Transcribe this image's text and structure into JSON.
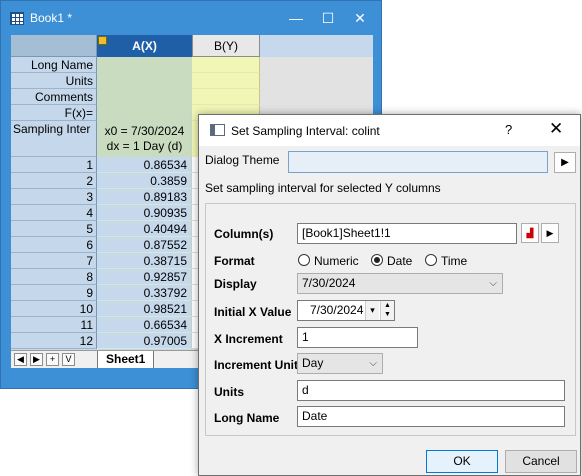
{
  "workbook": {
    "title": "Book1 *",
    "window_buttons": {
      "minimize": "—",
      "maximize": "☐",
      "close": "✕"
    },
    "columns": [
      {
        "label": "A(X)"
      },
      {
        "label": "B(Y)"
      }
    ],
    "row_labels": [
      "Long Name",
      "Units",
      "Comments",
      "F(x)=",
      "Sampling Inter"
    ],
    "sampling_text": [
      "x0 = 7/30/2024",
      "dx = 1 Day (d)"
    ],
    "rows": [
      {
        "n": "1",
        "a": "0.86534"
      },
      {
        "n": "2",
        "a": "0.3859"
      },
      {
        "n": "3",
        "a": "0.89183"
      },
      {
        "n": "4",
        "a": "0.90935"
      },
      {
        "n": "5",
        "a": "0.40494"
      },
      {
        "n": "6",
        "a": "0.87552"
      },
      {
        "n": "7",
        "a": "0.38715"
      },
      {
        "n": "8",
        "a": "0.92857"
      },
      {
        "n": "9",
        "a": "0.33792"
      },
      {
        "n": "10",
        "a": "0.98521"
      },
      {
        "n": "11",
        "a": "0.66534"
      },
      {
        "n": "12",
        "a": "0.97005"
      }
    ],
    "sheet_nav": [
      "◀",
      "▶",
      "+",
      "V"
    ],
    "sheet_tab": "Sheet1"
  },
  "dialog": {
    "title": "Set Sampling Interval: colint",
    "help": "?",
    "close": "✕",
    "theme_label": "Dialog Theme",
    "theme_value": "",
    "theme_button": "▶",
    "description": "Set sampling interval for selected Y columns",
    "columns_label": "Column(s)",
    "columns_value": "[Book1]Sheet1!1",
    "format_label": "Format",
    "format_options": [
      "Numeric",
      "Date",
      "Time"
    ],
    "format_selected": "Date",
    "display_label": "Display",
    "display_value": "7/30/2024",
    "initial_label": "Initial X Value",
    "initial_value": "7/30/2024",
    "increment_label": "X Increment",
    "increment_value": "1",
    "unit_label": "Increment Unit",
    "unit_value": "Day",
    "units_label": "Units",
    "units_value": "d",
    "longname_label": "Long Name",
    "longname_value": "Date",
    "ok": "OK",
    "cancel": "Cancel"
  }
}
